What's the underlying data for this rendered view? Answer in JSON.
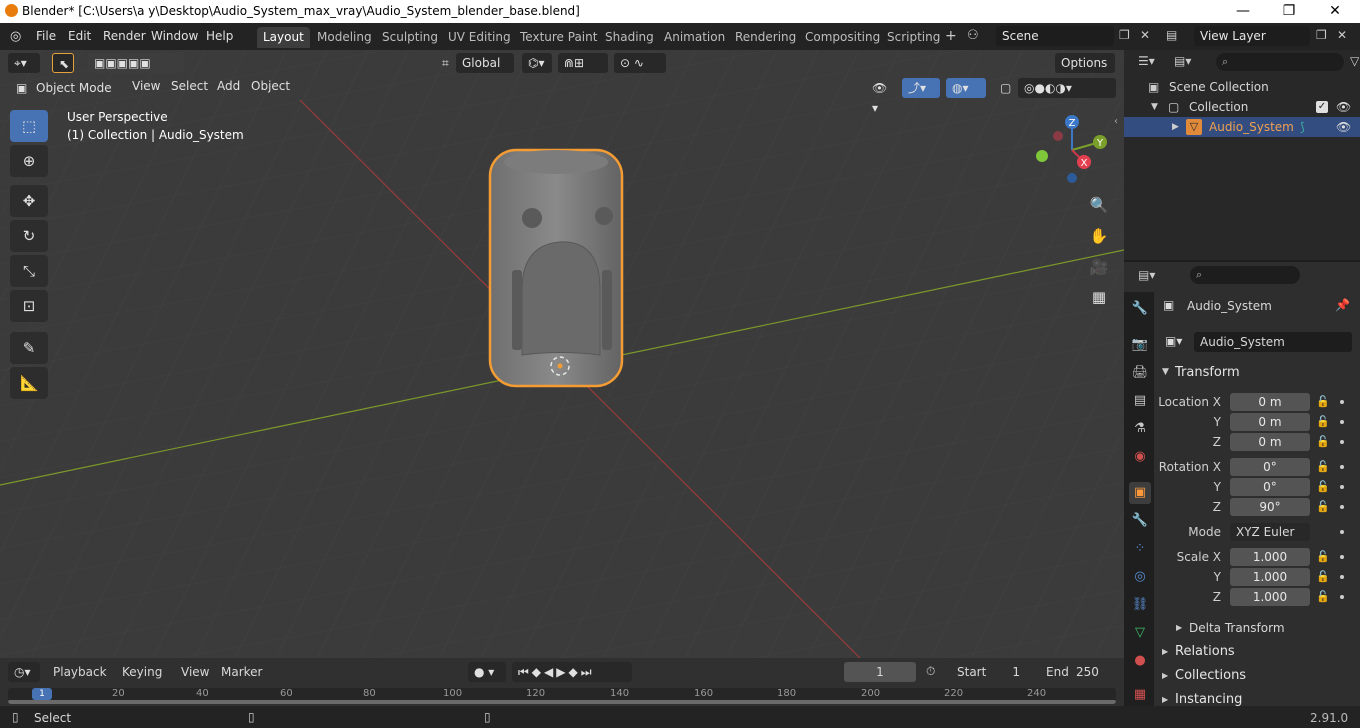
{
  "window": {
    "title": "Blender* [C:\\Users\\a y\\Desktop\\Audio_System_max_vray\\Audio_System_blender_base.blend]",
    "minimize": "—",
    "maximize": "❐",
    "close": "✕"
  },
  "menu": {
    "file": "File",
    "edit": "Edit",
    "render": "Render",
    "window": "Window",
    "help": "Help"
  },
  "workspaces": [
    "Layout",
    "Modeling",
    "Sculpting",
    "UV Editing",
    "Texture Paint",
    "Shading",
    "Animation",
    "Rendering",
    "Compositing",
    "Scripting"
  ],
  "active_workspace": "Layout",
  "scene": {
    "name": "Scene",
    "view_layer": "View Layer"
  },
  "toolbar": {
    "orientation": "Global",
    "options": "Options"
  },
  "viewport": {
    "mode": "Object Mode",
    "view": "View",
    "select": "Select",
    "add": "Add",
    "object": "Object",
    "perspective": "User Perspective",
    "collection_info": "(1) Collection | Audio_System",
    "gizmo": {
      "z": "Z",
      "y": "Y",
      "x": "X"
    }
  },
  "outliner": {
    "scene_collection": "Scene Collection",
    "collection": "Collection",
    "object": "Audio_System"
  },
  "properties": {
    "object_name": "Audio_System",
    "data_name": "Audio_System",
    "transform": "Transform",
    "location_x_label": "Location X",
    "y_label": "Y",
    "z_label": "Z",
    "rotation_x_label": "Rotation X",
    "location": [
      "0 m",
      "0 m",
      "0 m"
    ],
    "rotation": [
      "0°",
      "0°",
      "90°"
    ],
    "mode_label": "Mode",
    "mode": "XYZ Euler",
    "scale_x_label": "Scale X",
    "scale": [
      "1.000",
      "1.000",
      "1.000"
    ],
    "delta_transform": "Delta Transform",
    "relations": "Relations",
    "collections": "Collections",
    "instancing": "Instancing"
  },
  "timeline": {
    "playback": "Playback",
    "keying": "Keying",
    "view": "View",
    "marker": "Marker",
    "current_frame": "1",
    "start_label": "Start",
    "start": "1",
    "end_label": "End",
    "end": "250",
    "ruler": [
      "20",
      "40",
      "60",
      "80",
      "100",
      "120",
      "140",
      "160",
      "180",
      "200",
      "220",
      "240"
    ],
    "ruler_current": "1"
  },
  "status": {
    "select": "Select",
    "version": "2.91.0"
  },
  "colors": {
    "accent": "#4772b3",
    "selection": "#ff9a3c",
    "header": "#232323",
    "viewport": "#3b3b3b"
  }
}
